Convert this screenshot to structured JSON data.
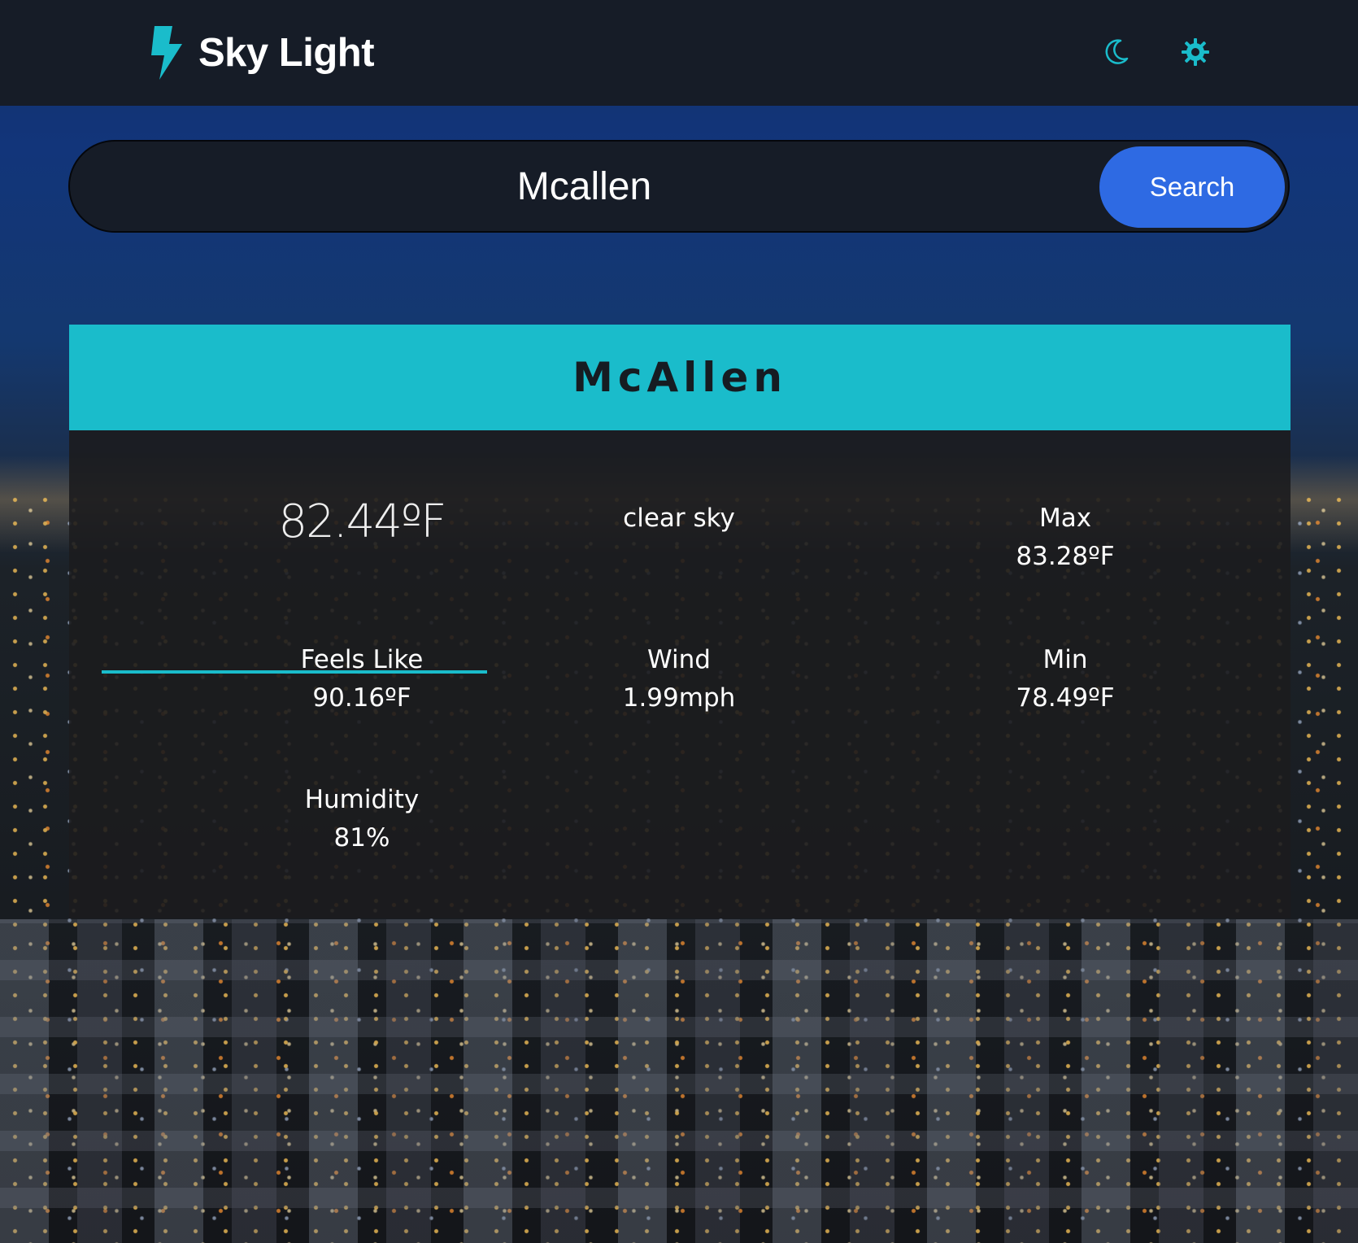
{
  "app": {
    "title": "Sky Light",
    "accent_color": "#1abccb",
    "button_color": "#2e6ae3"
  },
  "header": {
    "logo_icon": "lightning-bolt-icon",
    "theme_icons": [
      "moon-icon",
      "gear-icon"
    ]
  },
  "search": {
    "value": "Mcallen",
    "button_label": "Search"
  },
  "weather": {
    "city": "McAllen",
    "temperature": "82.44ºF",
    "description": "clear sky",
    "max_label": "Max",
    "max_value": "83.28ºF",
    "feels_like_label": "Feels Like",
    "feels_like_value": "90.16ºF",
    "wind_label": "Wind",
    "wind_value": "1.99mph",
    "min_label": "Min",
    "min_value": "78.49ºF",
    "humidity_label": "Humidity",
    "humidity_value": "81%"
  }
}
